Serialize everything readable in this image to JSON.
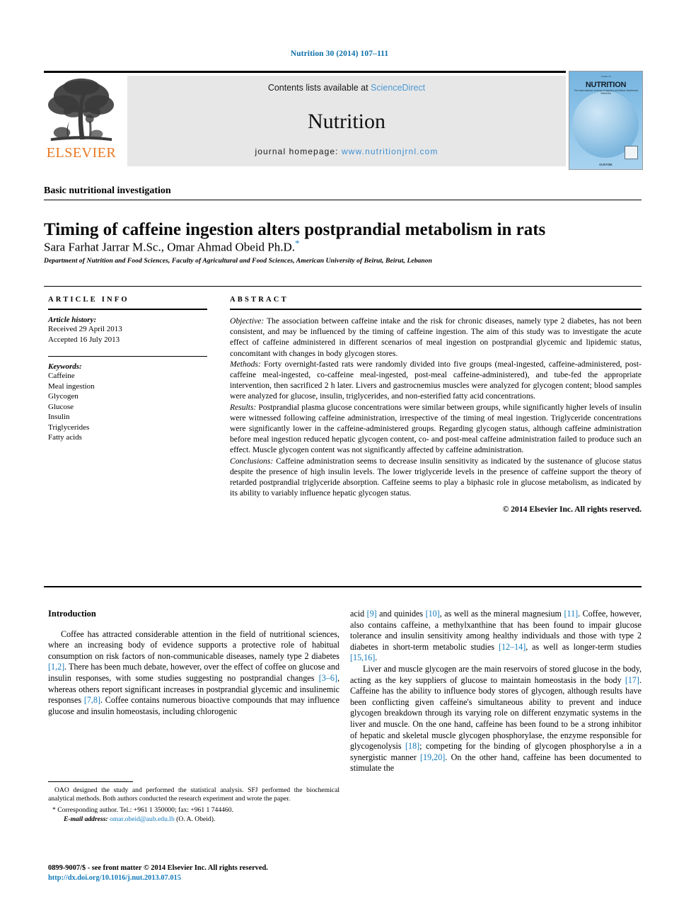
{
  "running_head": "Nutrition 30 (2014) 107–111",
  "masthead": {
    "contents_prefix": "Contents lists available at ",
    "sciencedirect": "ScienceDirect",
    "journal_name": "Nutrition",
    "homepage_prefix": "journal homepage: ",
    "homepage_url": "www.nutritionjrnl.com",
    "publisher_logo_text": "ELSEVIER",
    "cover": {
      "title": "NUTRITION",
      "subtitle": "The International Journal of Applied and Basic Nutritional Sciences",
      "micro_top": "Volume 30",
      "footer": "ELSEVIER"
    },
    "colors": {
      "link_blue": "#4c9ad4",
      "elsevier_orange": "#e87722",
      "band_gray": "#e7e7e7"
    }
  },
  "article": {
    "section_label": "Basic nutritional investigation",
    "title": "Timing of caffeine ingestion alters postprandial metabolism in rats",
    "authors": "Sara Farhat Jarrar M.Sc., Omar Ahmad Obeid Ph.D.",
    "corresponding_marker": "*",
    "affiliation": "Department of Nutrition and Food Sciences, Faculty of Agricultural and Food Sciences, American University of Beirut, Beirut, Lebanon"
  },
  "article_info": {
    "heading": "ARTICLE INFO",
    "history_label": "Article history:",
    "received": "Received 29 April 2013",
    "accepted": "Accepted 16 July 2013",
    "keywords_label": "Keywords:",
    "keywords": [
      "Caffeine",
      "Meal ingestion",
      "Glycogen",
      "Glucose",
      "Insulin",
      "Triglycerides",
      "Fatty acids"
    ]
  },
  "abstract": {
    "heading": "ABSTRACT",
    "objective_label": "Objective:",
    "objective_text": " The association between caffeine intake and the risk for chronic diseases, namely type 2 diabetes, has not been consistent, and may be influenced by the timing of caffeine ingestion. The aim of this study was to investigate the acute effect of caffeine administered in different scenarios of meal ingestion on postprandial glycemic and lipidemic status, concomitant with changes in body glycogen stores.",
    "methods_label": "Methods:",
    "methods_text": " Forty overnight-fasted rats were randomly divided into five groups (meal-ingested, caffeine-administered, post-caffeine meal-ingested, co-caffeine meal-ingested, post-meal caffeine-administered), and tube-fed the appropriate intervention, then sacrificed 2 h later. Livers and gastrocnemius muscles were analyzed for glycogen content; blood samples were analyzed for glucose, insulin, triglycerides, and non-esterified fatty acid concentrations.",
    "results_label": "Results:",
    "results_text": " Postprandial plasma glucose concentrations were similar between groups, while significantly higher levels of insulin were witnessed following caffeine administration, irrespective of the timing of meal ingestion. Triglyceride concentrations were significantly lower in the caffeine-administered groups. Regarding glycogen status, although caffeine administration before meal ingestion reduced hepatic glycogen content, co- and post-meal caffeine administration failed to produce such an effect. Muscle glycogen content was not significantly affected by caffeine administration.",
    "conclusions_label": "Conclusions:",
    "conclusions_text": " Caffeine administration seems to decrease insulin sensitivity as indicated by the sustenance of glucose status despite the presence of high insulin levels. The lower triglyceride levels in the presence of caffeine support the theory of retarded postprandial triglyceride absorption. Caffeine seems to play a biphasic role in glucose metabolism, as indicated by its ability to variably influence hepatic glycogen status.",
    "copyright": "© 2014 Elsevier Inc. All rights reserved."
  },
  "introduction": {
    "heading": "Introduction",
    "left_paragraph_1_a": "Coffee has attracted considerable attention in the field of nutritional sciences, where an increasing body of evidence supports a protective role of habitual consumption on risk factors of non-communicable diseases, namely type 2 diabetes ",
    "ref_1_2": "[1,2]",
    "left_paragraph_1_b": ". There has been much debate, however, over the effect of coffee on glucose and insulin responses, with some studies suggesting no postprandial changes ",
    "ref_3_6": "[3–6]",
    "left_paragraph_1_c": ", whereas others report significant increases in postprandial glycemic and insulinemic responses ",
    "ref_7_8": "[7,8]",
    "left_paragraph_1_d": ". Coffee contains numerous bioactive compounds that may influence glucose and insulin homeostasis, including chlorogenic",
    "right_paragraph_1_a": "acid ",
    "ref_9": "[9]",
    "right_paragraph_1_b": " and quinides ",
    "ref_10": "[10]",
    "right_paragraph_1_c": ", as well as the mineral magnesium ",
    "ref_11": "[11]",
    "right_paragraph_1_d": ". Coffee, however, also contains caffeine, a methylxanthine that has been found to impair glucose tolerance and insulin sensitivity among healthy individuals and those with type 2 diabetes in short-term metabolic studies ",
    "ref_12_14": "[12–14]",
    "right_paragraph_1_e": ", as well as longer-term studies ",
    "ref_15_16": "[15,16]",
    "right_paragraph_1_f": ".",
    "right_paragraph_2_a": "Liver and muscle glycogen are the main reservoirs of stored glucose in the body, acting as the key suppliers of glucose to maintain homeostasis in the body ",
    "ref_17": "[17]",
    "right_paragraph_2_b": ". Caffeine has the ability to influence body stores of glycogen, although results have been conflicting given caffeine's simultaneous ability to prevent and induce glycogen breakdown through its varying role on different enzymatic systems in the liver and muscle. On the one hand, caffeine has been found to be a strong inhibitor of hepatic and skeletal muscle glycogen phosphorylase, the enzyme responsible for glycogenolysis ",
    "ref_18": "[18]",
    "right_paragraph_2_c": "; competing for the binding of glycogen phosphorylse a in a synergistic manner ",
    "ref_19_20": "[19,20]",
    "right_paragraph_2_d": ". On the other hand, caffeine has been documented to stimulate the"
  },
  "footnotes": {
    "contributions_a": "OAO designed the study and performed the statistical analysis. SFJ performed the biochemical analytical methods. Both authors conducted the research experiment and wrote the paper.",
    "corresponding": "* Corresponding author. Tel.: +961 1 350000; fax: +961 1 744460.",
    "email_label": "E-mail address:",
    "email_address": "omar.obeid@aub.edu.lb",
    "email_suffix": " (O. A. Obeid).",
    "issn_line": "0899-9007/$ - see front matter © 2014 Elsevier Inc. All rights reserved.",
    "doi": "http://dx.doi.org/10.1016/j.nut.2013.07.015"
  }
}
